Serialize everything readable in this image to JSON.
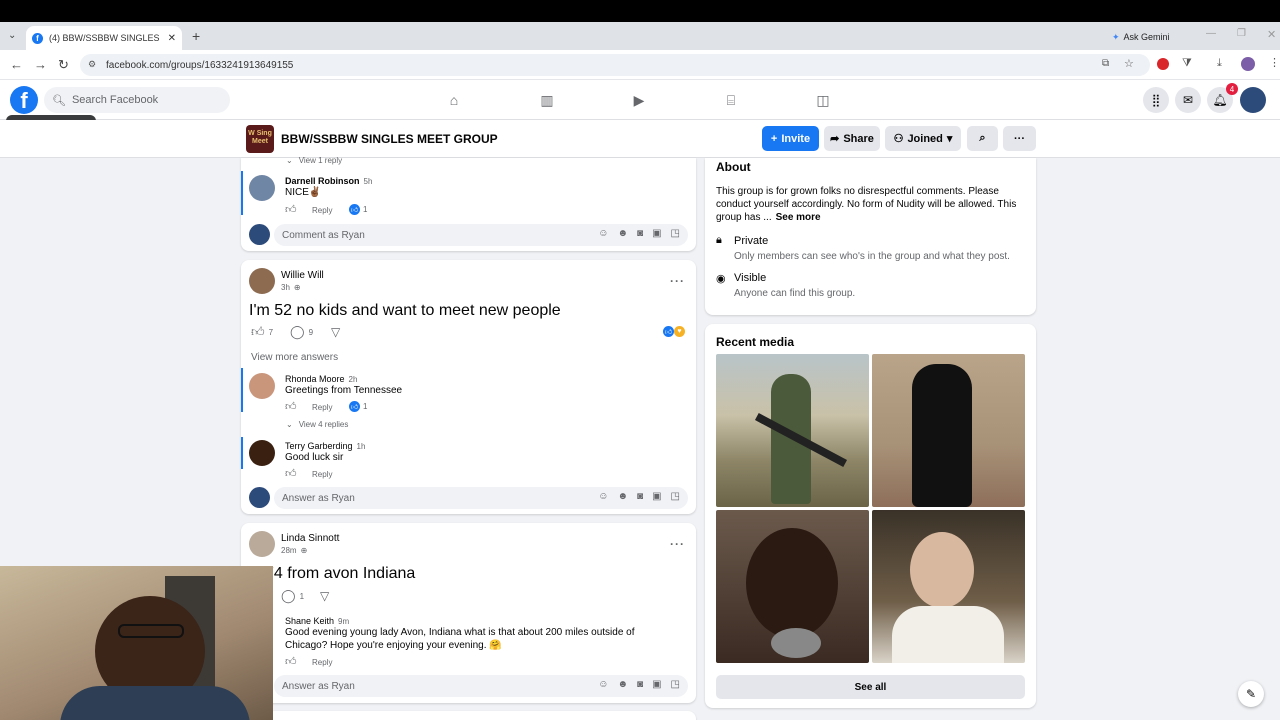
{
  "browser": {
    "tab_title": "(4) BBW/SSBBW SINGLES MEET",
    "url": "facebook.com/groups/1633241913649155",
    "ask_gemini": "Ask Gemini"
  },
  "fb": {
    "search_placeholder": "Search Facebook",
    "esc_tooltip": "Press Esc to close",
    "notifications_count": "4"
  },
  "group": {
    "logo_text": "W Sing Meet",
    "name": "BBW/SSBBW SINGLES MEET GROUP",
    "invite": "Invite",
    "share": "Share",
    "joined": "Joined"
  },
  "post1": {
    "view_reply": "View 1 reply",
    "comment_author": "Darnell Robinson",
    "comment_time": "5h",
    "comment_text": "NICE✌🏾",
    "reply": "Reply",
    "likes": "1",
    "comment_placeholder": "Comment as Ryan"
  },
  "post2": {
    "author": "Willie Will",
    "time": "3h",
    "title": "I'm 52 no kids and want to meet new people",
    "likes": "7",
    "comments": "9",
    "view_more": "View more answers",
    "c1_author": "Rhonda Moore",
    "c1_time": "2h",
    "c1_text": "Greetings from Tennessee",
    "c1_reply": "Reply",
    "c1_likes": "1",
    "view_replies": "View 4 replies",
    "c2_author": "Terry Garberding",
    "c2_time": "1h",
    "c2_text": "Good luck sir",
    "c2_reply": "Reply",
    "answer_placeholder": "Answer as Ryan"
  },
  "post3": {
    "author": "Linda Sinnott",
    "time": "28m",
    "title": "74 from avon Indiana",
    "comments": "1",
    "c1_author": "Shane Keith",
    "c1_time": "9m",
    "c1_text_line1": "Good evening young lady Avon, Indiana what is that about 200 miles outside of",
    "c1_text_line2": "Chicago? Hope you're enjoying your evening. 🤗",
    "c1_reply": "Reply",
    "answer_placeholder": "Answer as Ryan"
  },
  "about": {
    "title": "About",
    "desc_line1": "This group is for grown folks no disrespectful comments. Please",
    "desc_line2": "conduct yourself accordingly. No form of Nudity will be allowed. This",
    "desc_line3": "group has ...",
    "see_more": "See more",
    "private_title": "Private",
    "private_desc": "Only members can see who's in the group and what they post.",
    "visible_title": "Visible",
    "visible_desc": "Anyone can find this group."
  },
  "recent_media": {
    "title": "Recent media",
    "see_all": "See all"
  },
  "colors": {
    "fb_blue": "#1877f2",
    "bg": "#f0f2f5"
  }
}
